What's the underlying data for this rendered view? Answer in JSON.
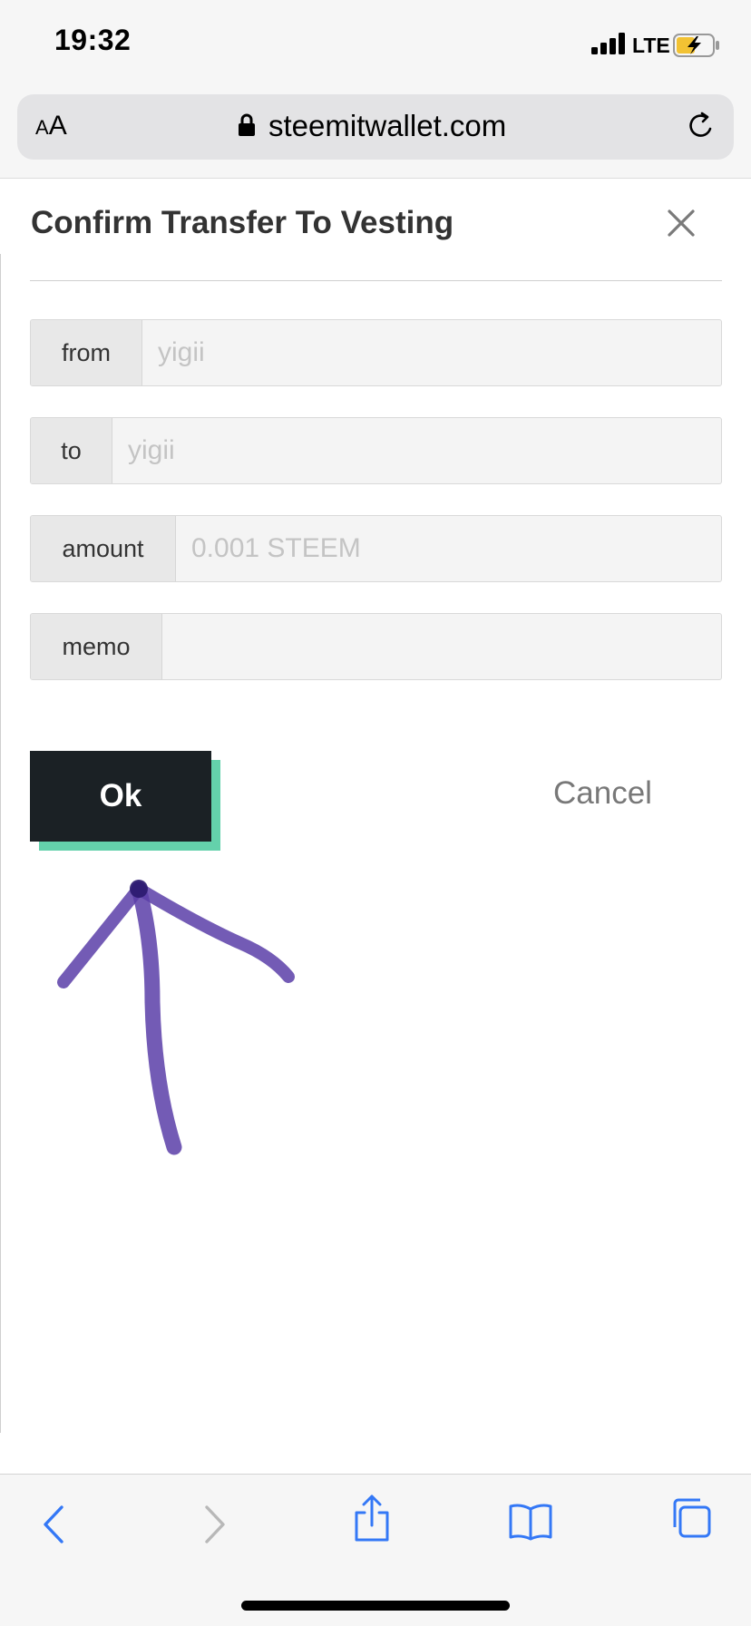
{
  "status_bar": {
    "time": "19:32",
    "network": "LTE",
    "icons": [
      "signal-icon",
      "battery-charging-icon"
    ]
  },
  "browser": {
    "text_size_label_small": "A",
    "text_size_label_large": "A",
    "url": "steemitwallet.com",
    "icons": [
      "lock-icon",
      "reload-icon"
    ]
  },
  "modal": {
    "title": "Confirm Transfer To Vesting",
    "close_icon": "close-icon",
    "fields": [
      {
        "label": "from",
        "value": "yigii"
      },
      {
        "label": "to",
        "value": "yigii"
      },
      {
        "label": "amount",
        "value": "0.001 STEEM"
      },
      {
        "label": "memo",
        "value": ""
      }
    ],
    "ok_label": "Ok",
    "cancel_label": "Cancel"
  },
  "annotation": {
    "icon": "hand-drawn-arrow-icon",
    "color": "#5a3ea8"
  },
  "toolbar": {
    "icons": [
      "back-icon",
      "forward-icon",
      "share-icon",
      "bookmarks-icon",
      "tabs-icon"
    ],
    "accent": "#3478f6"
  }
}
